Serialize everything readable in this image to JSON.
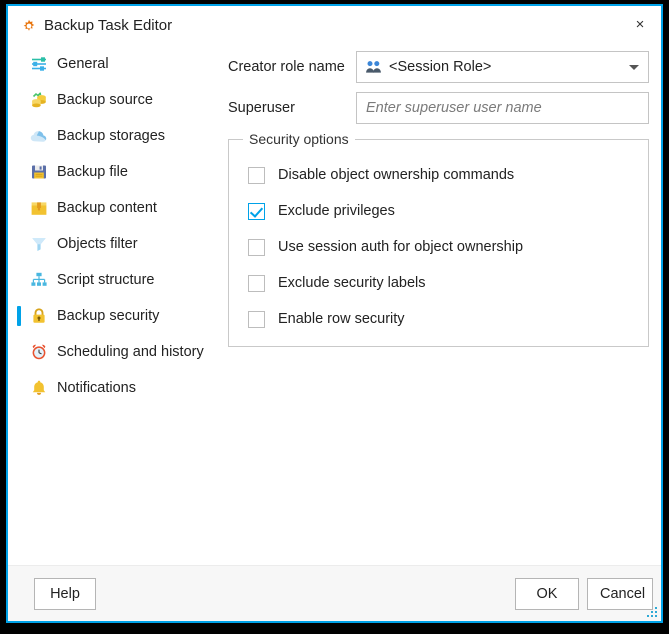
{
  "window": {
    "title": "Backup Task Editor",
    "title_icon": "gear-icon",
    "close_label": "×",
    "accent_color": "#00a2e8"
  },
  "sidebar": {
    "items": [
      {
        "label": "General",
        "icon": "sliders-icon",
        "selected": false
      },
      {
        "label": "Backup source",
        "icon": "coins-icon",
        "selected": false
      },
      {
        "label": "Backup storages",
        "icon": "cloud-icon",
        "selected": false
      },
      {
        "label": "Backup file",
        "icon": "floppy-disk-icon",
        "selected": false
      },
      {
        "label": "Backup content",
        "icon": "package-box-icon",
        "selected": false
      },
      {
        "label": "Objects filter",
        "icon": "funnel-filter-icon",
        "selected": false
      },
      {
        "label": "Script structure",
        "icon": "hierarchy-tree-icon",
        "selected": false
      },
      {
        "label": "Backup security",
        "icon": "padlock-icon",
        "selected": true
      },
      {
        "label": "Scheduling and history",
        "icon": "alarm-clock-icon",
        "selected": false
      },
      {
        "label": "Notifications",
        "icon": "bell-icon",
        "selected": false
      }
    ]
  },
  "main": {
    "creator_role": {
      "label": "Creator role name",
      "icon": "two-users-icon",
      "value": "<Session Role>",
      "arrow_icon": "chevron-down-icon"
    },
    "superuser": {
      "label": "Superuser",
      "value": "",
      "placeholder": "Enter superuser user name"
    },
    "security_options": {
      "title": "Security options",
      "checkboxes": [
        {
          "label": "Disable object ownership commands",
          "checked": false
        },
        {
          "label": "Exclude privileges",
          "checked": true
        },
        {
          "label": "Use session auth for object ownership",
          "checked": false
        },
        {
          "label": "Exclude security labels",
          "checked": false
        },
        {
          "label": "Enable row security",
          "checked": false
        }
      ]
    }
  },
  "footer": {
    "help_label": "Help",
    "ok_label": "OK",
    "cancel_label": "Cancel",
    "resize_grip": "resize-grip-icon"
  }
}
